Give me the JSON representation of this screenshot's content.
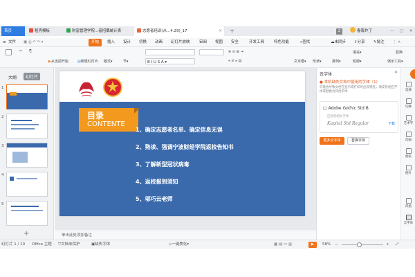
{
  "tabs": [
    {
      "label": "首页",
      "active": false
    },
    {
      "label": "稻壳模板",
      "active": false
    },
    {
      "label": "财富管理学院...者招募统计表",
      "active": false
    },
    {
      "label": "志愿者培训(从...4.29)_17",
      "active": true
    }
  ],
  "window": {
    "badge": "2",
    "user": "春箐炸了"
  },
  "menu": {
    "file": "文件",
    "items": [
      "开始",
      "插入",
      "设计",
      "切换",
      "动画",
      "幻灯片放映",
      "审阅",
      "视图",
      "安全",
      "开发工具",
      "特色功能"
    ],
    "search": "查找",
    "unsync": "未同步",
    "share": "分享",
    "batch": "批注"
  },
  "ribbon": {
    "from_current": "从当前开始",
    "new_slide": "新建幻灯片",
    "layout": "版式",
    "section": "节",
    "textbox": "文本框",
    "shape": "形状",
    "arrange": "排列",
    "fill": "填充",
    "outline": "轮廓",
    "presenter": "演示工具",
    "replace": "替换",
    "select": "选择"
  },
  "left_panel": {
    "tab_outline": "大纲",
    "tab_slides": "幻灯片",
    "slide_numbers": [
      "1",
      "2",
      "3",
      "4",
      "5"
    ]
  },
  "slide": {
    "heading_cn": "目录",
    "heading_en": "CONTENTE",
    "items": [
      "1、确定志愿者名单、确定信息无误",
      "2、熟读、强调宁波财经学院返校告知书",
      "3、了解新型冠状病毒",
      "4、返校报到须知",
      "5、邬巧云老师"
    ]
  },
  "notes_placeholder": "单击此处添加备注",
  "cloud_font_panel": {
    "title": "云字体",
    "warning": "本机缺失文档中使用的字体（1）",
    "desc": "可能会导致文档在显示或打印时出现错乱，请安装相应字体或替换为其他字体",
    "font_name": "Adobe Gothic Std B",
    "font_status": "匹配到相似字体",
    "font_preview": "Kapital Std Regular",
    "download": "下载",
    "more_button": "更多云字体",
    "replace_button": "替换字体"
  },
  "right_sidebar": [
    "选择",
    "切换",
    "艺术字",
    "动画",
    "图表",
    "图片",
    "风格",
    "云字体"
  ],
  "statusbar": {
    "slide_info": "幻灯片 1 / 10",
    "theme": "Office 主题",
    "doc_protect": "文档未保护",
    "missing_font": "缺失字体",
    "beautify": "一键美化",
    "zoom": "58%"
  },
  "colors": {
    "accent": "#f0731b",
    "slide_blue": "#3a6aac",
    "heading_orange": "#f39a1e"
  }
}
